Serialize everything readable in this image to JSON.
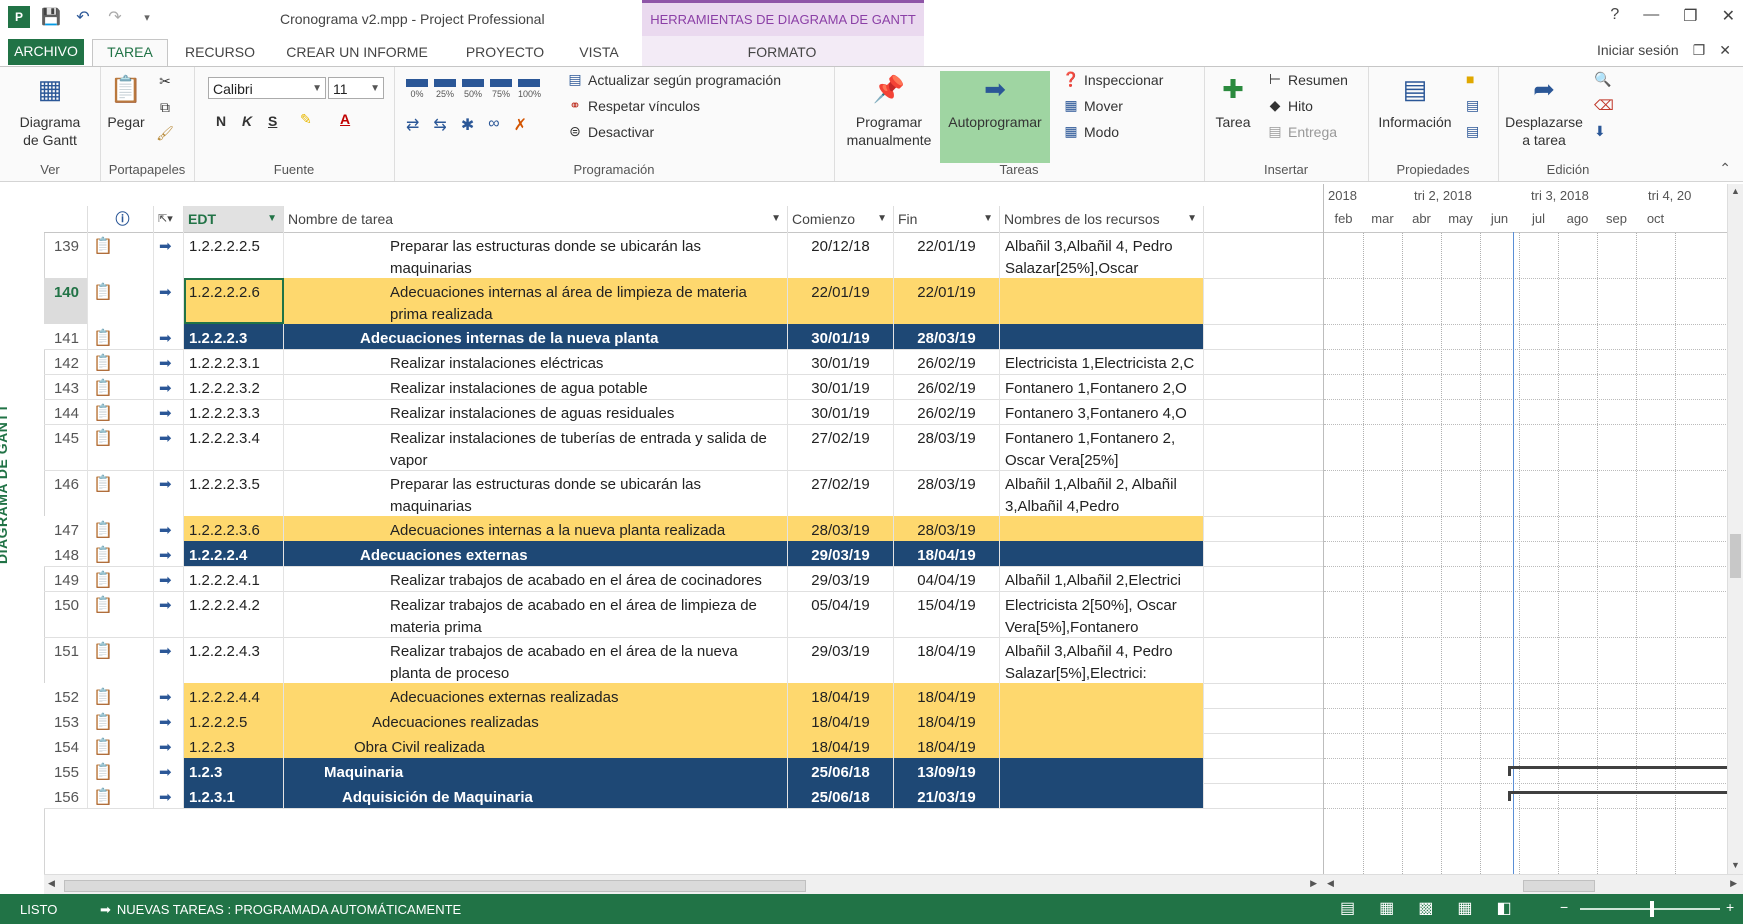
{
  "window": {
    "title": "Cronograma v2.mpp - Project Professional",
    "context_header": "HERRAMIENTAS DE DIAGRAMA DE GANTT",
    "help": "?",
    "minimize": "—",
    "restore": "❐",
    "close": "✕"
  },
  "tabs": {
    "archivo": "ARCHIVO",
    "tarea": "TAREA",
    "recurso": "RECURSO",
    "informe": "CREAR UN INFORME",
    "proyecto": "PROYECTO",
    "vista": "VISTA",
    "formato": "FORMATO",
    "signin": "Iniciar sesión"
  },
  "ribbon": {
    "ver": {
      "label": "Ver",
      "gantt": "Diagrama de Gantt"
    },
    "portapapeles": {
      "label": "Portapapeles",
      "pegar": "Pegar"
    },
    "fuente": {
      "label": "Fuente",
      "font": "Calibri",
      "size": "11",
      "bold": "N",
      "italic": "K",
      "underline": "S"
    },
    "programacion": {
      "label": "Programación",
      "actualizar": "Actualizar según programación",
      "respetar": "Respetar vínculos",
      "desactivar": "Desactivar",
      "pct": [
        "0%",
        "25%",
        "50%",
        "75%",
        "100%"
      ]
    },
    "tareas": {
      "label": "Tareas",
      "manual": "Programar manualmente",
      "auto": "Autoprogramar",
      "inspeccionar": "Inspeccionar",
      "mover": "Mover",
      "modo": "Modo"
    },
    "insertar": {
      "label": "Insertar",
      "tarea": "Tarea",
      "resumen": "Resumen",
      "hito": "Hito",
      "entrega": "Entrega"
    },
    "propiedades": {
      "label": "Propiedades",
      "informacion": "Información"
    },
    "edicion": {
      "label": "Edición",
      "desplazarse": "Desplazarse a tarea"
    }
  },
  "viewbar": {
    "label": "DIAGRAMA DE GANTT"
  },
  "columns": {
    "edt": "EDT",
    "nombre": "Nombre de tarea",
    "comienzo": "Comienzo",
    "fin": "Fin",
    "recursos": "Nombres de los recursos"
  },
  "rows": [
    {
      "id": "139",
      "edt": "1.2.2.2.2.5",
      "name": "Preparar las estructuras donde se ubicarán las maquinarias",
      "start": "20/12/18",
      "end": "22/01/19",
      "res": "Albañil 3,Albañil 4, Pedro Salazar[25%],Oscar",
      "type": "task"
    },
    {
      "id": "140",
      "edt": "1.2.2.2.2.6",
      "name": "Adecuaciones internas al área de limpieza de materia prima realizada",
      "start": "22/01/19",
      "end": "22/01/19",
      "res": "",
      "type": "milestone"
    },
    {
      "id": "141",
      "edt": "1.2.2.2.3",
      "name": "Adecuaciones internas de la nueva planta",
      "start": "30/01/19",
      "end": "28/03/19",
      "res": "",
      "type": "summary"
    },
    {
      "id": "142",
      "edt": "1.2.2.2.3.1",
      "name": "Realizar instalaciones eléctricas",
      "start": "30/01/19",
      "end": "26/02/19",
      "res": "Electricista 1,Electricista 2,C",
      "type": "task"
    },
    {
      "id": "143",
      "edt": "1.2.2.2.3.2",
      "name": "Realizar instalaciones de agua potable",
      "start": "30/01/19",
      "end": "26/02/19",
      "res": "Fontanero 1,Fontanero 2,O",
      "type": "task"
    },
    {
      "id": "144",
      "edt": "1.2.2.2.3.3",
      "name": "Realizar instalaciones de aguas residuales",
      "start": "30/01/19",
      "end": "26/02/19",
      "res": "Fontanero 3,Fontanero 4,O",
      "type": "task"
    },
    {
      "id": "145",
      "edt": "1.2.2.2.3.4",
      "name": "Realizar instalaciones de tuberías de entrada y salida de vapor",
      "start": "27/02/19",
      "end": "28/03/19",
      "res": "Fontanero 1,Fontanero 2, Oscar Vera[25%]",
      "type": "task"
    },
    {
      "id": "146",
      "edt": "1.2.2.2.3.5",
      "name": "Preparar las estructuras donde se ubicarán las maquinarias",
      "start": "27/02/19",
      "end": "28/03/19",
      "res": "Albañil 1,Albañil 2, Albañil 3,Albañil 4,Pedro",
      "type": "task"
    },
    {
      "id": "147",
      "edt": "1.2.2.2.3.6",
      "name": "Adecuaciones internas a la nueva planta realizada",
      "start": "28/03/19",
      "end": "28/03/19",
      "res": "",
      "type": "milestone"
    },
    {
      "id": "148",
      "edt": "1.2.2.2.4",
      "name": "Adecuaciones externas",
      "start": "29/03/19",
      "end": "18/04/19",
      "res": "",
      "type": "summary"
    },
    {
      "id": "149",
      "edt": "1.2.2.2.4.1",
      "name": "Realizar trabajos de acabado en el área de cocinadores",
      "start": "29/03/19",
      "end": "04/04/19",
      "res": "Albañil 1,Albañil 2,Electrici",
      "type": "task"
    },
    {
      "id": "150",
      "edt": "1.2.2.2.4.2",
      "name": "Realizar trabajos de acabado en el área de limpieza de materia prima",
      "start": "05/04/19",
      "end": "15/04/19",
      "res": "Electricista 2[50%], Oscar Vera[5%],Fontanero",
      "type": "task"
    },
    {
      "id": "151",
      "edt": "1.2.2.2.4.3",
      "name": "Realizar trabajos de acabado en el área de la nueva planta de proceso",
      "start": "29/03/19",
      "end": "18/04/19",
      "res": "Albañil 3,Albañil 4, Pedro Salazar[5%],Electrici:",
      "type": "task"
    },
    {
      "id": "152",
      "edt": "1.2.2.2.4.4",
      "name": "Adecuaciones externas realizadas",
      "start": "18/04/19",
      "end": "18/04/19",
      "res": "",
      "type": "milestone"
    },
    {
      "id": "153",
      "edt": "1.2.2.2.5",
      "name": "Adecuaciones realizadas",
      "start": "18/04/19",
      "end": "18/04/19",
      "res": "",
      "type": "milestone"
    },
    {
      "id": "154",
      "edt": "1.2.2.3",
      "name": "Obra Civil realizada",
      "start": "18/04/19",
      "end": "18/04/19",
      "res": "",
      "type": "milestone"
    },
    {
      "id": "155",
      "edt": "1.2.3",
      "name": "Maquinaria",
      "start": "25/06/18",
      "end": "13/09/19",
      "res": "",
      "type": "summary"
    },
    {
      "id": "156",
      "edt": "1.2.3.1",
      "name": "Adquisición de Maquinaria",
      "start": "25/06/18",
      "end": "21/03/19",
      "res": "",
      "type": "summary"
    }
  ],
  "timeline": {
    "quarters": [
      "2018",
      "tri 2, 2018",
      "tri 3, 2018",
      "tri 4, 20"
    ],
    "months": [
      "feb",
      "mar",
      "abr",
      "may",
      "jun",
      "jul",
      "ago",
      "sep",
      "oct"
    ]
  },
  "status": {
    "ready": "LISTO",
    "new_tasks": "NUEVAS TAREAS : PROGRAMADA AUTOMÁTICAMENTE"
  },
  "colors": {
    "accent": "#217346",
    "summary": "#1e4875",
    "milestone": "#fed86e",
    "context": "#8b3fa6"
  }
}
